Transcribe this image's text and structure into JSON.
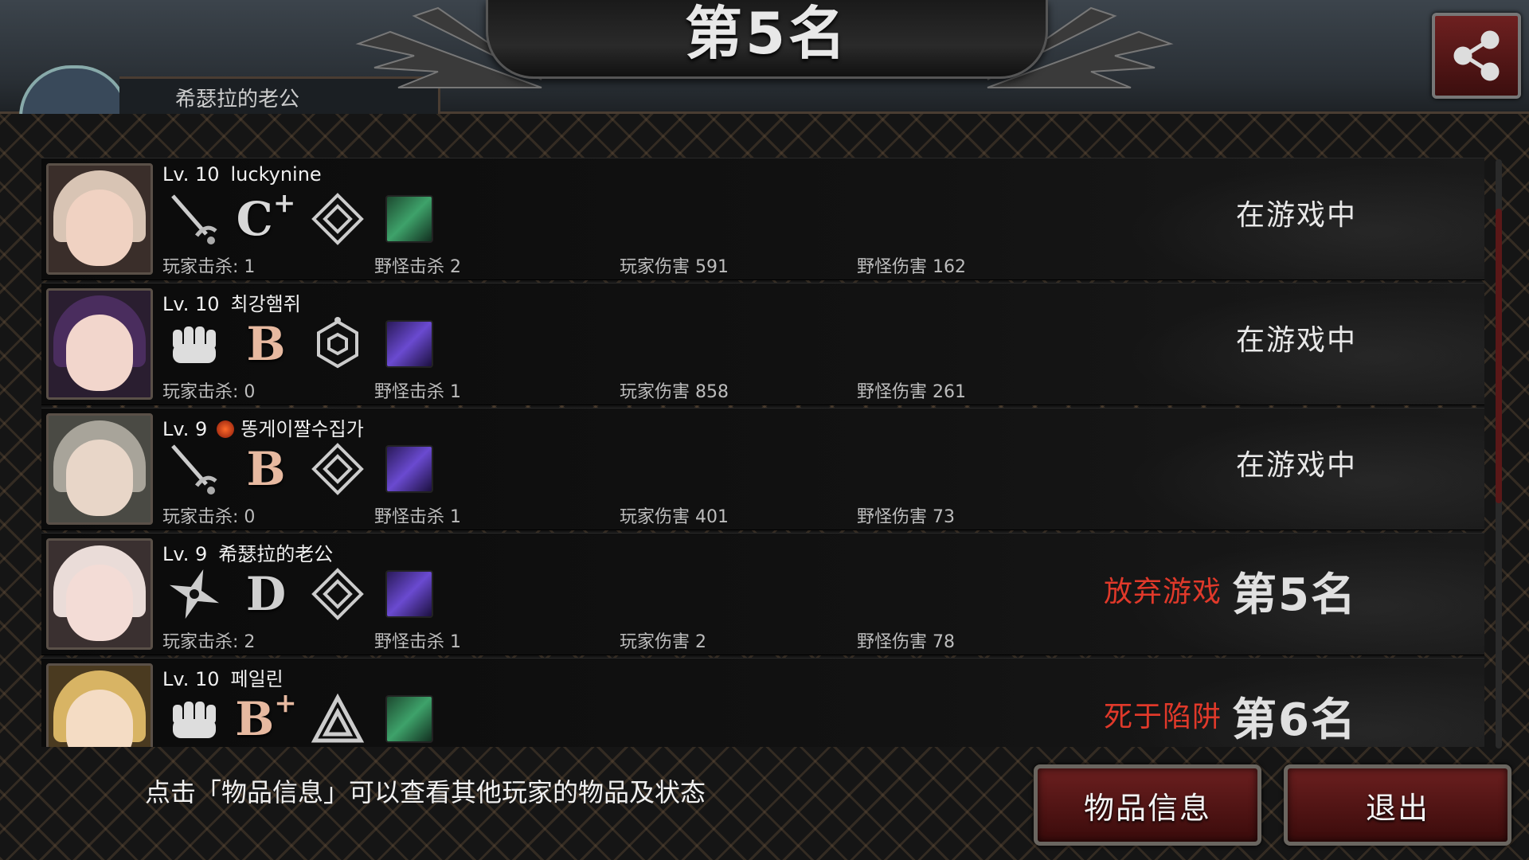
{
  "header": {
    "title": "第5名",
    "name_plate_text": "希瑟拉的老公",
    "share_icon": "share-icon"
  },
  "players": [
    {
      "lv_text": "Lv. 10",
      "name": "luckynine",
      "weapon_icon": "sword-icon",
      "grade": "C",
      "grade_plus": "+",
      "skill_icon": "diamond-rune-icon",
      "monster_icon": "green-soldier-icon",
      "player_kills": "玩家击杀: 1",
      "monster_kills": "野怪击杀 2",
      "player_damage": "玩家伤害 591",
      "monster_damage": "野怪伤害 162",
      "status": "在游戏中",
      "status_red": "",
      "rank": "",
      "skin": "#f0d2c2",
      "hair": "#d8c4b4"
    },
    {
      "lv_text": "Lv. 10",
      "name": "최강햄쥐",
      "weapon_icon": "fist-icon",
      "grade": "B",
      "grade_plus": "",
      "skill_icon": "hexagon-rune-icon",
      "monster_icon": "purple-beast-icon",
      "player_kills": "玩家击杀: 0",
      "monster_kills": "野怪击杀 1",
      "player_damage": "玩家伤害 858",
      "monster_damage": "野怪伤害 261",
      "status": "在游戏中",
      "status_red": "",
      "rank": "",
      "skin": "#f2d6cc",
      "hair": "#4a2d5e"
    },
    {
      "lv_text": "Lv. 9",
      "name": "똥게이짤수집가",
      "weapon_icon": "sword-icon",
      "grade": "B",
      "grade_plus": "",
      "skill_icon": "diamond-rune-icon",
      "monster_icon": "purple-beast-icon",
      "player_kills": "玩家击杀: 0",
      "monster_kills": "野怪击杀 1",
      "player_damage": "玩家伤害 401",
      "monster_damage": "野怪伤害 73",
      "status": "在游戏中",
      "status_red": "",
      "rank": "",
      "skin": "#e8d6c8",
      "hair": "#a8a49a"
    },
    {
      "lv_text": "Lv. 9",
      "name": "希瑟拉的老公",
      "weapon_icon": "shuriken-icon",
      "grade": "D",
      "grade_plus": "",
      "skill_icon": "diamond-rune-icon",
      "monster_icon": "purple-beast-icon",
      "player_kills": "玩家击杀: 2",
      "monster_kills": "野怪击杀 1",
      "player_damage": "玩家伤害 2",
      "monster_damage": "野怪伤害 78",
      "status": "",
      "status_red": "放弃游戏",
      "rank": "第5名",
      "skin": "#f3dcd6",
      "hair": "#eadcd8"
    },
    {
      "lv_text": "Lv. 10",
      "name": "페일린",
      "weapon_icon": "fist-icon",
      "grade": "B",
      "grade_plus": "+",
      "skill_icon": "triangle-rune-icon",
      "monster_icon": "green-soldier-icon",
      "player_kills": "",
      "monster_kills": "",
      "player_damage": "",
      "monster_damage": "",
      "status": "",
      "status_red": "死于陷阱",
      "rank": "第6名",
      "skin": "#f4dcc4",
      "hair": "#d8b464"
    }
  ],
  "footer": {
    "hint": "点击「物品信息」可以查看其他玩家的物品及状态",
    "items_button": "物品信息",
    "exit_button": "退出"
  }
}
